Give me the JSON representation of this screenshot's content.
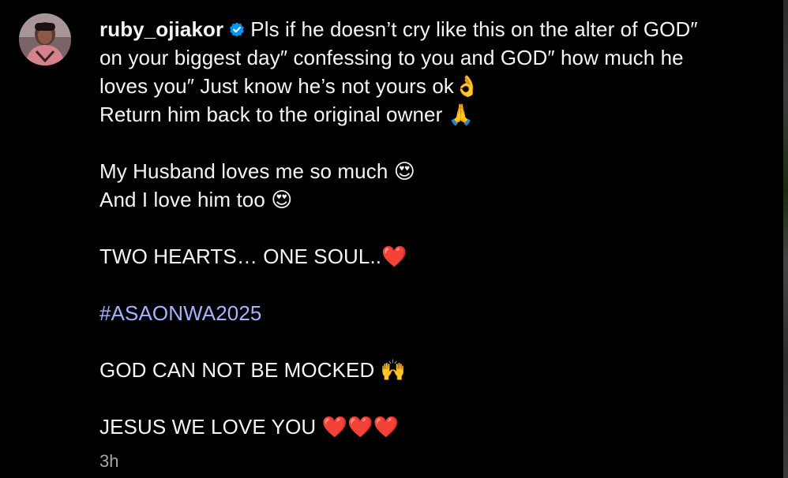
{
  "post": {
    "username": "ruby_ojiakor",
    "verified_badge": "verified-badge-icon",
    "verified_color": "#0095f6",
    "line1": "Pls if he doesn’t cry like this on the alter of GOD″",
    "line2": "on your biggest day″ confessing to you and GOD″ how much he",
    "line3": "loves you″ Just know he’s not yours ok👌",
    "line4": "Return him back to the original owner 🙏",
    "line5": "My Husband loves me so much 😍",
    "line6": "And I love him too 😍",
    "line7": "TWO HEARTS… ONE SOUL..❤️",
    "hashtag": "#ASAONWA2025",
    "hashtag_color": "#a8b3ff",
    "line8": "GOD CAN NOT BE MOCKED 🙌",
    "line9": "JESUS WE LOVE YOU ❤️❤️❤️",
    "timestamp": "3h"
  }
}
